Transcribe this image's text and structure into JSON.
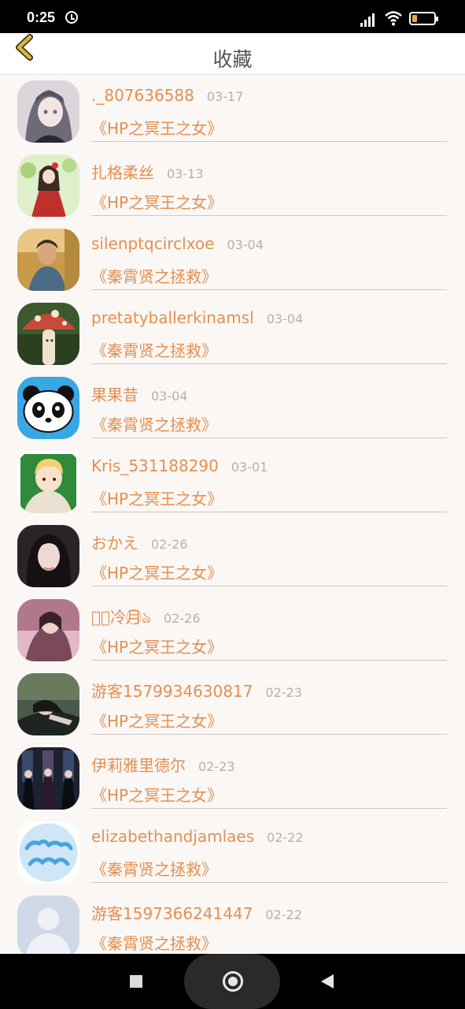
{
  "status_bar": {
    "time": "0:25"
  },
  "header": {
    "title": "收藏"
  },
  "items": [
    {
      "name": "._807636588",
      "date": "03-17",
      "book": "《HP之冥王之女》",
      "avatar": "anime-girl-avatar"
    },
    {
      "name": "扎格柔丝",
      "date": "03-13",
      "book": "《HP之冥王之女》",
      "avatar": "flower-girl-avatar"
    },
    {
      "name": "silenptqcirclxoe",
      "date": "03-04",
      "book": "《秦霄贤之拯救》",
      "avatar": "boy-photo-avatar"
    },
    {
      "name": "pretatyballerkinamsl",
      "date": "03-04",
      "book": "《秦霄贤之拯救》",
      "avatar": "mushroom-avatar"
    },
    {
      "name": "果果昔",
      "date": "03-04",
      "book": "《秦霄贤之拯救》",
      "avatar": "panda-avatar"
    },
    {
      "name": "Kris_531188290",
      "date": "03-01",
      "book": "《HP之冥王之女》",
      "avatar": "cartoon-boy-avatar"
    },
    {
      "name": "おかえ",
      "date": "02-26",
      "book": "《HP之冥王之女》",
      "avatar": "girl-photo-avatar"
    },
    {
      "name": "ঌ⃝冷月⃝ঌ",
      "date": "02-26",
      "book": "《HP之冥王之女》",
      "avatar": "pink-photo-avatar"
    },
    {
      "name": "游客1579934630817",
      "date": "02-23",
      "book": "《HP之冥王之女》",
      "avatar": "lying-girl-avatar"
    },
    {
      "name": "伊莉雅里德尔",
      "date": "02-23",
      "book": "《HP之冥王之女》",
      "avatar": "dark-group-avatar"
    },
    {
      "name": "elizabethandjamlaes",
      "date": "02-22",
      "book": "《秦霄贤之拯救》",
      "avatar": "blue-text-avatar"
    },
    {
      "name": "游客1597366241447",
      "date": "02-22",
      "book": "《秦霄贤之拯救》",
      "avatar": "default-user-avatar"
    }
  ],
  "colors": {
    "accent": "#e39052",
    "date": "#b7b0ab",
    "back_arrow": "#d9b838"
  }
}
